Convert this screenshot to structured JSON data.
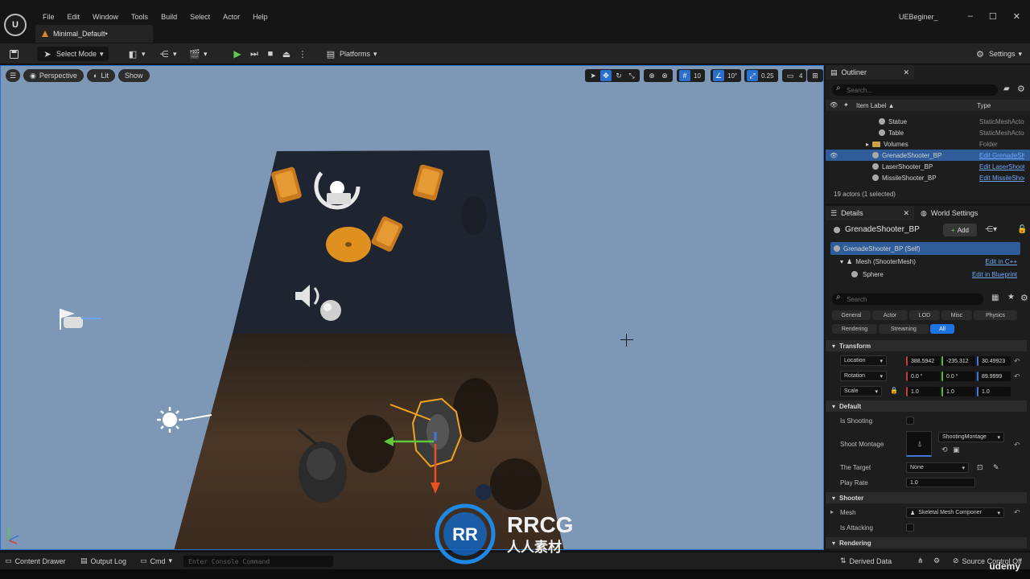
{
  "menu": [
    "File",
    "Edit",
    "Window",
    "Tools",
    "Build",
    "Select",
    "Actor",
    "Help"
  ],
  "document_tab": "Minimal_Default•",
  "project_name": "UEBeginer_",
  "toolbar": {
    "select_mode": "Select Mode",
    "platforms": "Platforms",
    "settings": "Settings"
  },
  "viewport": {
    "perspective": "Perspective",
    "lit": "Lit",
    "show": "Show",
    "grid_snap": "10",
    "rotation_snap": "10°",
    "scale_snap": "0.25",
    "camera_speed": "4"
  },
  "outliner": {
    "tab": "Outliner",
    "search_placeholder": "Search...",
    "col_label": "Item Label ▲",
    "col_type": "Type",
    "rows": [
      {
        "name": "Statue",
        "type": "StaticMeshActor",
        "kind": "mesh"
      },
      {
        "name": "Table",
        "type": "StaticMeshActor",
        "kind": "mesh"
      },
      {
        "name": "Volumes",
        "type": "Folder",
        "kind": "folder"
      },
      {
        "name": "GrenadeShooter_BP",
        "type": "Edit GrenadeShooter",
        "kind": "bp"
      },
      {
        "name": "LaserShooter_BP",
        "type": "Edit LaserShooter",
        "kind": "bp"
      },
      {
        "name": "MissileShooter_BP",
        "type": "Edit MissileShooter",
        "kind": "bp"
      }
    ],
    "actor_count": "19 actors (1 selected)"
  },
  "details": {
    "tab": "Details",
    "tab2": "World Settings",
    "actor_name": "GrenadeShooter_BP",
    "add_label": "Add",
    "components": [
      {
        "name": "GrenadeShooter_BP (Self)",
        "link": ""
      },
      {
        "name": "Mesh (ShooterMesh)",
        "link": "Edit in C++"
      },
      {
        "name": "Sphere",
        "link": "Edit in Blueprint"
      }
    ],
    "search_placeholder": "Search",
    "filters_row1": [
      "General",
      "Actor",
      "LOD",
      "Misc",
      "Physics"
    ],
    "filters_row2": [
      "Rendering",
      "Streaming",
      "All"
    ],
    "sections": {
      "transform": "Transform",
      "default": "Default",
      "shooter": "Shooter",
      "rendering": "Rendering"
    },
    "transform": {
      "location_label": "Location",
      "location": [
        "388.5942",
        "-235.312",
        "30.49923"
      ],
      "rotation_label": "Rotation",
      "rotation": [
        "0.0 °",
        "0.0 °",
        "89.9999"
      ],
      "scale_label": "Scale",
      "scale": [
        "1.0",
        "1.0",
        "1.0"
      ]
    },
    "props": {
      "is_shooting": "Is Shooting",
      "shoot_montage": "Shoot Montage",
      "shoot_montage_value": "ShootingMontage",
      "the_target": "The Target",
      "the_target_value": "None",
      "play_rate": "Play Rate",
      "play_rate_value": "1.0",
      "mesh": "Mesh",
      "mesh_value": "Skeletal Mesh Componer",
      "is_attacking": "Is Attacking"
    }
  },
  "statusbar": {
    "content_drawer": "Content Drawer",
    "output_log": "Output Log",
    "cmd": "Cmd",
    "console_placeholder": "Enter Console Command",
    "derived_data": "Derived Data",
    "source_control": "Source Control Off"
  },
  "watermark": {
    "brand": "RRCG",
    "sub": "人人素材"
  },
  "udemy": "udemy",
  "colors": {
    "accent": "#2a6fcc",
    "selection": "#2f5d9a",
    "sky": "#7d97b7",
    "floor_dark": "#1f2530",
    "floor_brown": "#3b2c20"
  }
}
